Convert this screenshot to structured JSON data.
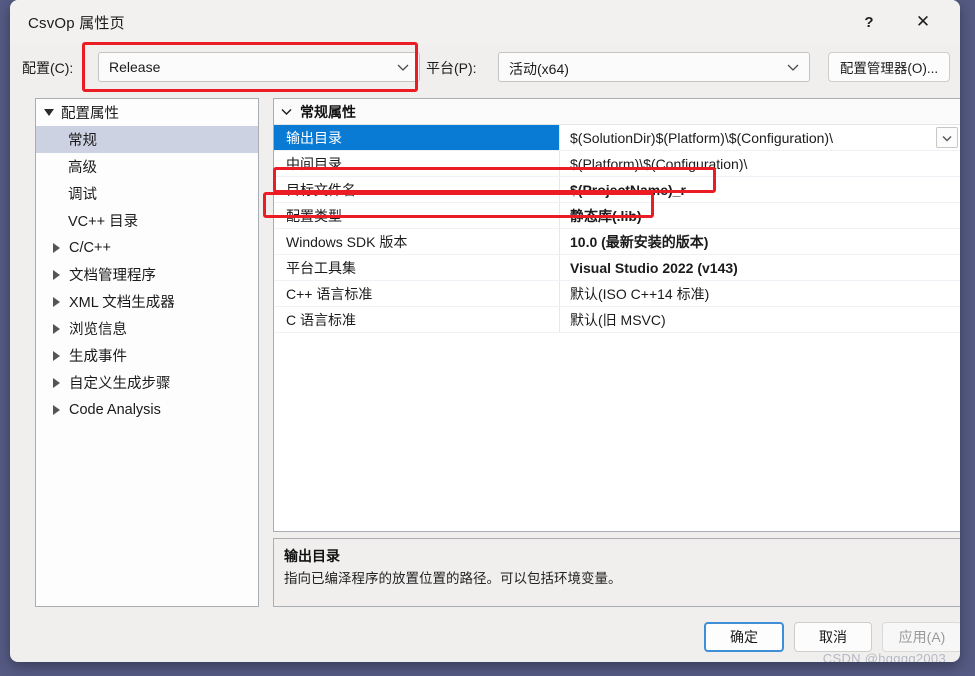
{
  "window": {
    "title": "CsvOp 属性页",
    "help_icon": "?",
    "close_icon": "✕"
  },
  "config_bar": {
    "config_label": "配置(C):",
    "config_value": "Release",
    "platform_label": "平台(P):",
    "platform_value": "活动(x64)",
    "config_manager_button": "配置管理器(O)..."
  },
  "tree": {
    "items": [
      {
        "label": "配置属性",
        "level": 0,
        "expander": "down",
        "selected": false
      },
      {
        "label": "常规",
        "level": 1,
        "expander": "none",
        "selected": true
      },
      {
        "label": "高级",
        "level": 1,
        "expander": "none",
        "selected": false
      },
      {
        "label": "调试",
        "level": 1,
        "expander": "none",
        "selected": false
      },
      {
        "label": "VC++ 目录",
        "level": 1,
        "expander": "none",
        "selected": false
      },
      {
        "label": "C/C++",
        "level": 1,
        "expander": "right",
        "selected": false
      },
      {
        "label": "文档管理程序",
        "level": 1,
        "expander": "right",
        "selected": false
      },
      {
        "label": "XML 文档生成器",
        "level": 1,
        "expander": "right",
        "selected": false
      },
      {
        "label": "浏览信息",
        "level": 1,
        "expander": "right",
        "selected": false
      },
      {
        "label": "生成事件",
        "level": 1,
        "expander": "right",
        "selected": false
      },
      {
        "label": "自定义生成步骤",
        "level": 1,
        "expander": "right",
        "selected": false
      },
      {
        "label": "Code Analysis",
        "level": 1,
        "expander": "right",
        "selected": false
      }
    ]
  },
  "grid": {
    "section_header": "常规属性",
    "rows": [
      {
        "name": "输出目录",
        "value": "$(SolutionDir)$(Platform)\\$(Configuration)\\",
        "selected": true,
        "bold": false,
        "dropdown": true
      },
      {
        "name": "中间目录",
        "value": "$(Platform)\\$(Configuration)\\",
        "selected": false,
        "bold": false,
        "dropdown": false
      },
      {
        "name": "目标文件名",
        "value": "$(ProjectName)_r",
        "selected": false,
        "bold": true,
        "dropdown": false
      },
      {
        "name": "配置类型",
        "value": "静态库(.lib)",
        "selected": false,
        "bold": true,
        "dropdown": false
      },
      {
        "name": "Windows SDK 版本",
        "value": "10.0 (最新安装的版本)",
        "selected": false,
        "bold": true,
        "dropdown": false
      },
      {
        "name": "平台工具集",
        "value": "Visual Studio 2022 (v143)",
        "selected": false,
        "bold": true,
        "dropdown": false
      },
      {
        "name": "C++ 语言标准",
        "value": "默认(ISO C++14 标准)",
        "selected": false,
        "bold": false,
        "dropdown": false
      },
      {
        "name": "C 语言标准",
        "value": "默认(旧 MSVC)",
        "selected": false,
        "bold": false,
        "dropdown": false
      }
    ]
  },
  "description": {
    "title": "输出目录",
    "body": "指向已编泽程序的放置位置的路径。可以包括环境变量。"
  },
  "footer": {
    "ok": "确定",
    "cancel": "取消",
    "apply": "应用(A)"
  },
  "watermark": "CSDN @hgggg2003",
  "annotations": {
    "accent_red": "#EC1C24",
    "selection_blue": "#0A7BD4",
    "tree_selection": "#CCD2E2"
  }
}
